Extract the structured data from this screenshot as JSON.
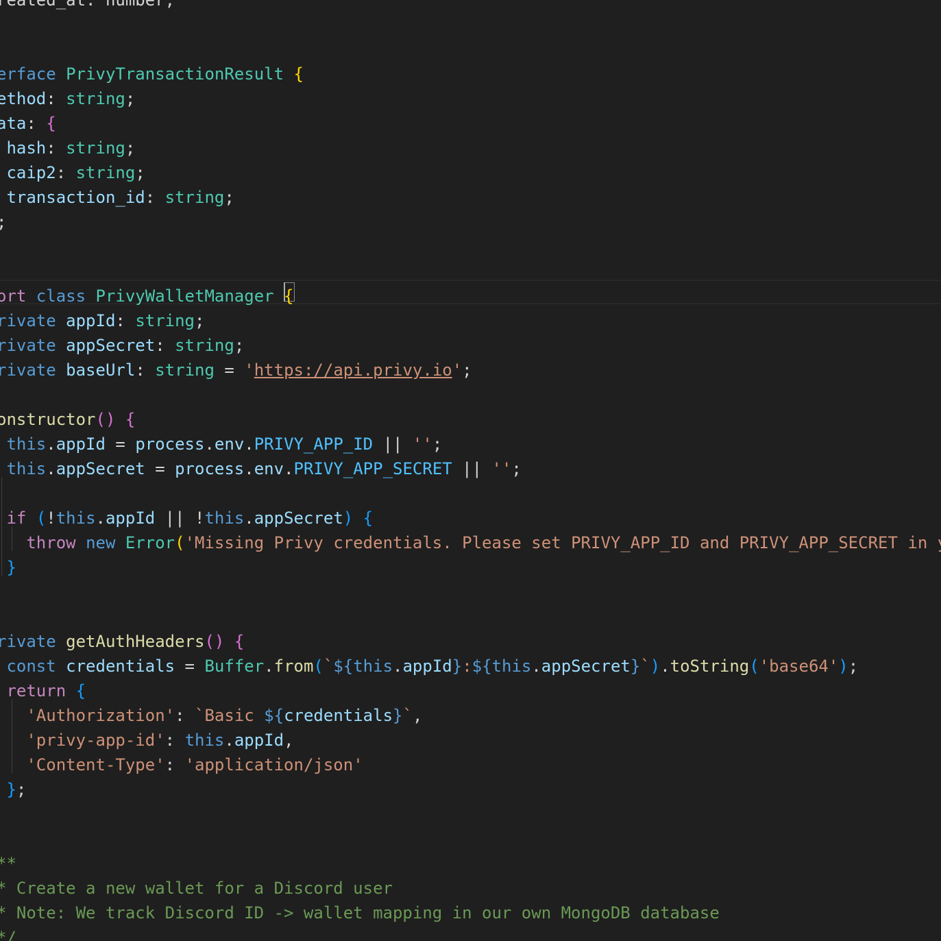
{
  "colors": {
    "background": "#1f1f1f",
    "keyword": "#569cd6",
    "control": "#c586c0",
    "type": "#4ec9b0",
    "property": "#9cdcfe",
    "function": "#dcdcaa",
    "string": "#ce9178",
    "comment": "#6a9955",
    "constant": "#4fc1ff",
    "bracket_gold": "#ffd700",
    "bracket_violet": "#da70d6",
    "bracket_blue": "#179fff",
    "plain": "#d4d4d4"
  },
  "code_lines": [
    [
      [
        "reated_at: number;",
        "plain"
      ]
    ],
    [],
    [],
    [
      [
        "erface ",
        "keyword"
      ],
      [
        "PrivyTransactionResult",
        "type"
      ],
      [
        " ",
        "plain"
      ],
      [
        "{",
        "bracket_gold"
      ]
    ],
    [
      [
        "ethod",
        "property"
      ],
      [
        ": ",
        "plain"
      ],
      [
        "string",
        "type"
      ],
      [
        ";",
        "plain"
      ]
    ],
    [
      [
        "ata",
        "property"
      ],
      [
        ": ",
        "plain"
      ],
      [
        "{",
        "bracket_violet"
      ]
    ],
    [
      [
        " hash",
        "property"
      ],
      [
        ": ",
        "plain"
      ],
      [
        "string",
        "type"
      ],
      [
        ";",
        "plain"
      ]
    ],
    [
      [
        " caip2",
        "property"
      ],
      [
        ": ",
        "plain"
      ],
      [
        "string",
        "type"
      ],
      [
        ";",
        "plain"
      ]
    ],
    [
      [
        " transaction_id",
        "property"
      ],
      [
        ": ",
        "plain"
      ],
      [
        "string",
        "type"
      ],
      [
        ";",
        "plain"
      ]
    ],
    [
      [
        ";",
        "plain"
      ]
    ],
    [],
    [],
    [
      [
        "ort ",
        "control"
      ],
      [
        "class ",
        "keyword"
      ],
      [
        "PrivyWalletManager",
        "type"
      ],
      [
        " ",
        "plain"
      ],
      [
        "{",
        "bracket_gold"
      ]
    ],
    [
      [
        "rivate ",
        "keyword"
      ],
      [
        "appId",
        "property"
      ],
      [
        ": ",
        "plain"
      ],
      [
        "string",
        "type"
      ],
      [
        ";",
        "plain"
      ]
    ],
    [
      [
        "rivate ",
        "keyword"
      ],
      [
        "appSecret",
        "property"
      ],
      [
        ": ",
        "plain"
      ],
      [
        "string",
        "type"
      ],
      [
        ";",
        "plain"
      ]
    ],
    [
      [
        "rivate ",
        "keyword"
      ],
      [
        "baseUrl",
        "property"
      ],
      [
        ": ",
        "plain"
      ],
      [
        "string",
        "type"
      ],
      [
        " = ",
        "plain"
      ],
      [
        "'",
        "string"
      ],
      [
        "https://api.privy.io",
        "string-link"
      ],
      [
        "'",
        "string"
      ],
      [
        ";",
        "plain"
      ]
    ],
    [],
    [
      [
        "onstructor",
        "function"
      ],
      [
        "()",
        "bracket_violet"
      ],
      [
        " ",
        "plain"
      ],
      [
        "{",
        "bracket_violet"
      ]
    ],
    [
      [
        " ",
        "plain"
      ],
      [
        "this",
        "keyword"
      ],
      [
        ".",
        "plain"
      ],
      [
        "appId",
        "property"
      ],
      [
        " = ",
        "plain"
      ],
      [
        "process",
        "property"
      ],
      [
        ".",
        "plain"
      ],
      [
        "env",
        "property"
      ],
      [
        ".",
        "plain"
      ],
      [
        "PRIVY_APP_ID",
        "constant"
      ],
      [
        " || ",
        "plain"
      ],
      [
        "''",
        "string"
      ],
      [
        ";",
        "plain"
      ]
    ],
    [
      [
        " ",
        "plain"
      ],
      [
        "this",
        "keyword"
      ],
      [
        ".",
        "plain"
      ],
      [
        "appSecret",
        "property"
      ],
      [
        " = ",
        "plain"
      ],
      [
        "process",
        "property"
      ],
      [
        ".",
        "plain"
      ],
      [
        "env",
        "property"
      ],
      [
        ".",
        "plain"
      ],
      [
        "PRIVY_APP_SECRET",
        "constant"
      ],
      [
        " || ",
        "plain"
      ],
      [
        "''",
        "string"
      ],
      [
        ";",
        "plain"
      ]
    ],
    [],
    [
      [
        " ",
        "plain"
      ],
      [
        "if",
        "control"
      ],
      [
        " ",
        "plain"
      ],
      [
        "(",
        "bracket_blue"
      ],
      [
        "!",
        "plain"
      ],
      [
        "this",
        "keyword"
      ],
      [
        ".",
        "plain"
      ],
      [
        "appId",
        "property"
      ],
      [
        " || !",
        "plain"
      ],
      [
        "this",
        "keyword"
      ],
      [
        ".",
        "plain"
      ],
      [
        "appSecret",
        "property"
      ],
      [
        ")",
        "bracket_blue"
      ],
      [
        " ",
        "plain"
      ],
      [
        "{",
        "bracket_blue"
      ]
    ],
    [
      [
        "   ",
        "plain"
      ],
      [
        "throw",
        "control"
      ],
      [
        " ",
        "plain"
      ],
      [
        "new",
        "keyword"
      ],
      [
        " ",
        "plain"
      ],
      [
        "Error",
        "type"
      ],
      [
        "(",
        "bracket_gold"
      ],
      [
        "'Missing Privy credentials. Please set PRIVY_APP_ID and PRIVY_APP_SECRET in y",
        "string"
      ]
    ],
    [
      [
        " ",
        "plain"
      ],
      [
        "}",
        "bracket_blue"
      ]
    ],
    [],
    [],
    [
      [
        "rivate ",
        "keyword"
      ],
      [
        "getAuthHeaders",
        "function"
      ],
      [
        "()",
        "bracket_violet"
      ],
      [
        " ",
        "plain"
      ],
      [
        "{",
        "bracket_violet"
      ]
    ],
    [
      [
        " ",
        "plain"
      ],
      [
        "const",
        "keyword"
      ],
      [
        " ",
        "plain"
      ],
      [
        "credentials",
        "property"
      ],
      [
        " = ",
        "plain"
      ],
      [
        "Buffer",
        "type"
      ],
      [
        ".",
        "plain"
      ],
      [
        "from",
        "function"
      ],
      [
        "(",
        "bracket_blue"
      ],
      [
        "`",
        "string"
      ],
      [
        "${",
        "keyword"
      ],
      [
        "this",
        "keyword"
      ],
      [
        ".",
        "plain"
      ],
      [
        "appId",
        "property"
      ],
      [
        "}",
        "keyword"
      ],
      [
        ":",
        "string"
      ],
      [
        "${",
        "keyword"
      ],
      [
        "this",
        "keyword"
      ],
      [
        ".",
        "plain"
      ],
      [
        "appSecret",
        "property"
      ],
      [
        "}",
        "keyword"
      ],
      [
        "`",
        "string"
      ],
      [
        ")",
        "bracket_blue"
      ],
      [
        ".",
        "plain"
      ],
      [
        "toString",
        "function"
      ],
      [
        "(",
        "bracket_blue"
      ],
      [
        "'base64'",
        "string"
      ],
      [
        ")",
        "bracket_blue"
      ],
      [
        ";",
        "plain"
      ]
    ],
    [
      [
        " ",
        "plain"
      ],
      [
        "return",
        "control"
      ],
      [
        " ",
        "plain"
      ],
      [
        "{",
        "bracket_blue"
      ]
    ],
    [
      [
        "   ",
        "plain"
      ],
      [
        "'Authorization'",
        "string"
      ],
      [
        ": ",
        "plain"
      ],
      [
        "`Basic ",
        "string"
      ],
      [
        "${",
        "keyword"
      ],
      [
        "credentials",
        "property"
      ],
      [
        "}",
        "keyword"
      ],
      [
        "`",
        "string"
      ],
      [
        ",",
        "plain"
      ]
    ],
    [
      [
        "   ",
        "plain"
      ],
      [
        "'privy-app-id'",
        "string"
      ],
      [
        ": ",
        "plain"
      ],
      [
        "this",
        "keyword"
      ],
      [
        ".",
        "plain"
      ],
      [
        "appId",
        "property"
      ],
      [
        ",",
        "plain"
      ]
    ],
    [
      [
        "   ",
        "plain"
      ],
      [
        "'Content-Type'",
        "string"
      ],
      [
        ": ",
        "plain"
      ],
      [
        "'application/json'",
        "string"
      ]
    ],
    [
      [
        " ",
        "plain"
      ],
      [
        "}",
        "bracket_blue"
      ],
      [
        ";",
        "plain"
      ]
    ],
    [],
    [],
    [
      [
        "**",
        "comment"
      ]
    ],
    [
      [
        "* Create a new wallet for a Discord user",
        "comment"
      ]
    ],
    [
      [
        "* Note: We track Discord ID -> wallet mapping in our own MongoDB database",
        "comment"
      ]
    ],
    [
      [
        "*/",
        "comment"
      ]
    ]
  ]
}
